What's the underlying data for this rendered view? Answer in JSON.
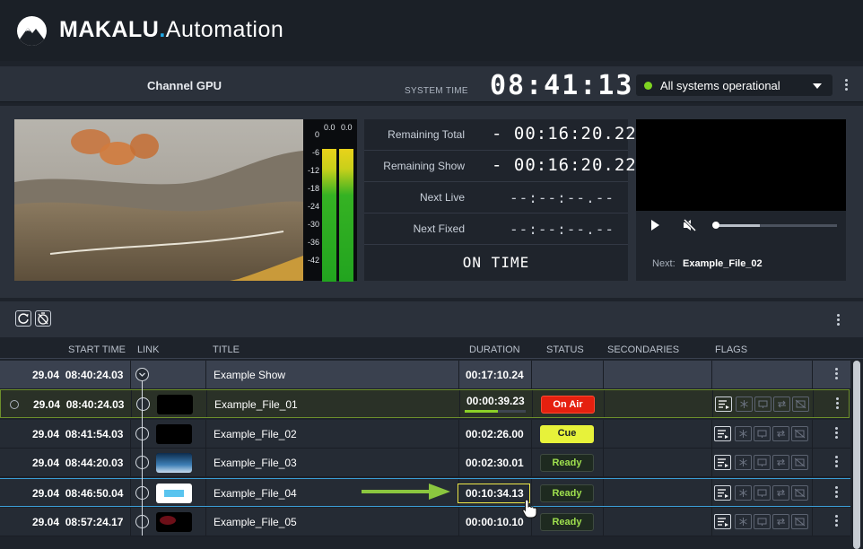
{
  "brand": {
    "name_part1": "MAKALU",
    "dot": ".",
    "name_part2": "Automation"
  },
  "channel": {
    "name": "Channel GPU",
    "system_time_label": "SYSTEM TIME",
    "system_time": "08:41:13",
    "status": "All systems operational",
    "status_color": "#7ed321"
  },
  "vu_meter": {
    "scale": [
      "0",
      "-6",
      "-12",
      "-18",
      "-24",
      "-30",
      "-36",
      "-42"
    ],
    "left_peak": "0.0",
    "right_peak": "0.0"
  },
  "timers": [
    {
      "label": "Remaining Total",
      "value": "- 00:16:20.22"
    },
    {
      "label": "Remaining Show",
      "value": "- 00:16:20.22"
    },
    {
      "label": "Next Live",
      "value": "--:--:--.--"
    },
    {
      "label": "Next Fixed",
      "value": "--:--:--.--"
    }
  ],
  "on_time": "ON TIME",
  "preview": {
    "next_label": "Next:",
    "next_value": "Example_File_02",
    "seek_fraction": 0.37
  },
  "table": {
    "headers": {
      "start_time": "START TIME",
      "link": "LINK",
      "title": "TITLE",
      "duration": "DURATION",
      "status": "STATUS",
      "secondaries": "SECONDARIES",
      "flags": "FLAGS"
    },
    "rows": [
      {
        "date": "29.04",
        "start": "08:40:24.03",
        "title": "Example Show",
        "duration": "00:17:10.24",
        "status": ""
      },
      {
        "date": "29.04",
        "start": "08:40:24.03",
        "title": "Example_File_01",
        "duration": "00:00:39.23",
        "status": "On Air",
        "progress": 0.55
      },
      {
        "date": "29.04",
        "start": "08:41:54.03",
        "title": "Example_File_02",
        "duration": "00:02:26.00",
        "status": "Cue"
      },
      {
        "date": "29.04",
        "start": "08:44:20.03",
        "title": "Example_File_03",
        "duration": "00:02:30.01",
        "status": "Ready"
      },
      {
        "date": "29.04",
        "start": "08:46:50.04",
        "title": "Example_File_04",
        "duration": "00:10:34.13",
        "status": "Ready"
      },
      {
        "date": "29.04",
        "start": "08:57:24.17",
        "title": "Example_File_05",
        "duration": "00:00:10.10",
        "status": "Ready"
      }
    ]
  },
  "colors": {
    "accent": "#1fa9e8",
    "on_air": "#e5200f",
    "cue": "#e7f23a",
    "ready_text": "#9fe04e",
    "arrow": "#8bc63f"
  }
}
